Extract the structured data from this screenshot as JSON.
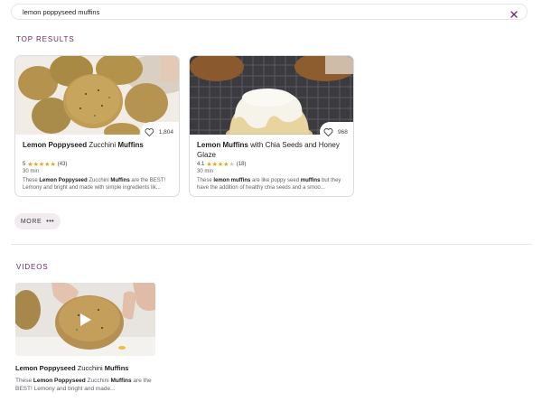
{
  "search": {
    "value": "lemon poppyseed muffins",
    "clear_icon": "close-icon"
  },
  "top_results": {
    "heading": "TOP RESULTS",
    "cards": [
      {
        "title_bold": "Lemon Poppyseed",
        "title_rest": " Zucchini ",
        "title_bold2": "Muffins",
        "save_count": "1,804",
        "rating": "5",
        "stars_filled": 5,
        "stars_total": 5,
        "review_count": "(43)",
        "time": "30 min",
        "snippet_pre": "These ",
        "snippet_bold1": "Lemon Poppyseed",
        "snippet_mid": " Zucchini ",
        "snippet_bold2": "Muffins",
        "snippet_post": " are the BEST! Lemony and bright and made with simple ingredients lik..."
      },
      {
        "title_bold": "Lemon Muffins",
        "title_rest": " with Chia Seeds and Honey Glaze",
        "title_bold2": "",
        "save_count": "968",
        "rating": "4.1",
        "stars_filled": 4,
        "stars_total": 5,
        "review_count": "(18)",
        "time": "30 min",
        "snippet_pre": "These ",
        "snippet_bold1": "lemon muffins",
        "snippet_mid": " are like poppy seed ",
        "snippet_bold2": "muffins",
        "snippet_post": " but they have the addition of healthy chia seeds and a smoo..."
      }
    ],
    "more_label": "MORE",
    "more_dots": "•••"
  },
  "videos": {
    "heading": "VIDEOS",
    "items": [
      {
        "title_bold": "Lemon Poppyseed",
        "title_rest": " Zucchini ",
        "title_bold2": "Muffins",
        "snippet_pre": "These ",
        "snippet_bold1": "Lemon Poppyseed",
        "snippet_mid": " Zucchini ",
        "snippet_bold2": "Muffins",
        "snippet_post": " are the BEST! Lemony and bright and made..."
      }
    ]
  },
  "colors": {
    "accent": "#6b2a63",
    "star": "#e8a41b",
    "more_bg": "#f2ecf1"
  }
}
